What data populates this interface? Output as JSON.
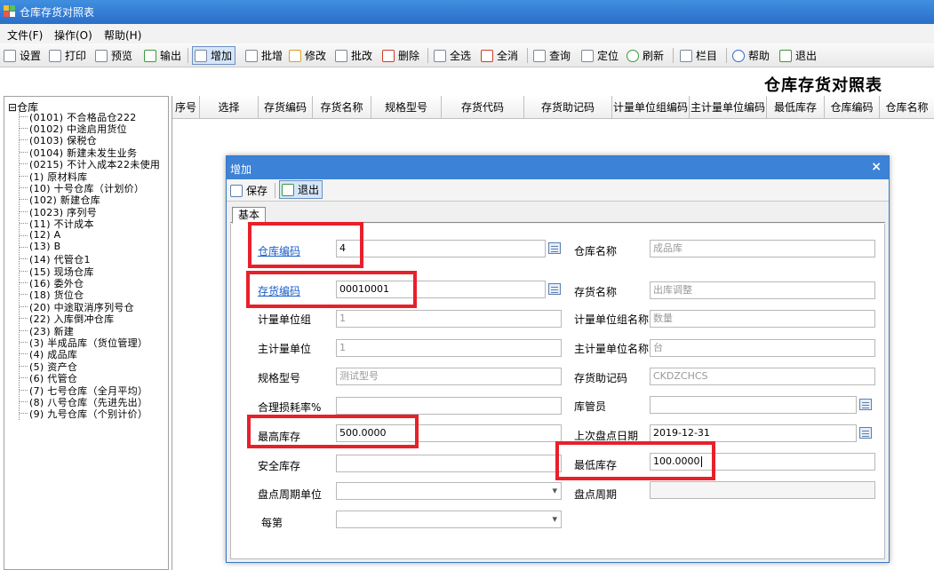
{
  "window": {
    "title": "仓库存货对照表"
  },
  "menu": [
    "文件(F)",
    "操作(O)",
    "帮助(H)"
  ],
  "toolbar": [
    "设置",
    "打印",
    "预览",
    "输出",
    "增加",
    "批增",
    "修改",
    "批改",
    "删除",
    "全选",
    "全消",
    "查询",
    "定位",
    "刷新",
    "栏目",
    "帮助",
    "退出"
  ],
  "headline": "仓库存货对照表",
  "tree": {
    "root": "仓库",
    "nodes": [
      "(0101) 不合格品仓222",
      "(0102) 中途启用货位",
      "(0103) 保税仓",
      "(0104) 新建未发生业务",
      "(0215) 不计入成本22未使用",
      "(1) 原材料库",
      "(10) 十号仓库（计划价）",
      "(102) 新建仓库",
      "(1023) 序列号",
      "(11) 不计成本",
      "(12) A",
      "(13) B",
      "(14) 代管仓1",
      "(15) 现场仓库",
      "(16) 委外仓",
      "(18) 货位仓",
      "(20) 中途取消序列号仓",
      "(22) 入库倒冲仓库",
      "(23) 新建",
      "(3) 半成品库（货位管理）",
      "(4) 成品库",
      "(5) 资产仓",
      "(6) 代管仓",
      "(7) 七号仓库（全月平均）",
      "(8) 八号仓库（先进先出）",
      "(9) 九号仓库（个别计价）"
    ]
  },
  "grid": {
    "columns": [
      "序号",
      "选择",
      "存货编码",
      "存货名称",
      "规格型号",
      "存货代码",
      "存货助记码",
      "计量单位组编码",
      "主计量单位编码",
      "最低库存",
      "仓库编码",
      "仓库名称"
    ]
  },
  "dialog": {
    "title": "增加",
    "close": "×",
    "save": "保存",
    "exit": "退出",
    "tab": "基本",
    "fields": {
      "warehouse_code": {
        "label": "仓库编码",
        "value": "4"
      },
      "warehouse_name": {
        "label": "仓库名称",
        "value": "成品库"
      },
      "inventory_code": {
        "label": "存货编码",
        "value": "00010001"
      },
      "inventory_name": {
        "label": "存货名称",
        "value": "出库调整"
      },
      "uom_group": {
        "label": "计量单位组",
        "value": "1"
      },
      "uom_group_name": {
        "label": "计量单位组名称",
        "value": "数量"
      },
      "main_uom": {
        "label": "主计量单位",
        "value": "1"
      },
      "main_uom_name": {
        "label": "主计量单位名称",
        "value": "台"
      },
      "spec": {
        "label": "规格型号",
        "value": "测试型号"
      },
      "mnemonic": {
        "label": "存货助记码",
        "value": "CKDZCHCS"
      },
      "loss_rate": {
        "label": "合理损耗率%",
        "value": ""
      },
      "keeper": {
        "label": "库管员",
        "value": ""
      },
      "max_stock": {
        "label": "最高库存",
        "value": "500.0000"
      },
      "last_check_date": {
        "label": "上次盘点日期",
        "value": "2019-12-31"
      },
      "safety_stock": {
        "label": "安全库存",
        "value": ""
      },
      "min_stock": {
        "label": "最低库存",
        "value": "100.0000"
      },
      "check_cycle_unit": {
        "label": "盘点周期单位",
        "value": ""
      },
      "check_cycle": {
        "label": "盘点周期",
        "value": ""
      },
      "every": {
        "label": "每第",
        "value": ""
      }
    }
  },
  "colors": {
    "highlight": "#e8202a",
    "title_bar": "#3c82d6",
    "link": "#1a5fc8"
  }
}
